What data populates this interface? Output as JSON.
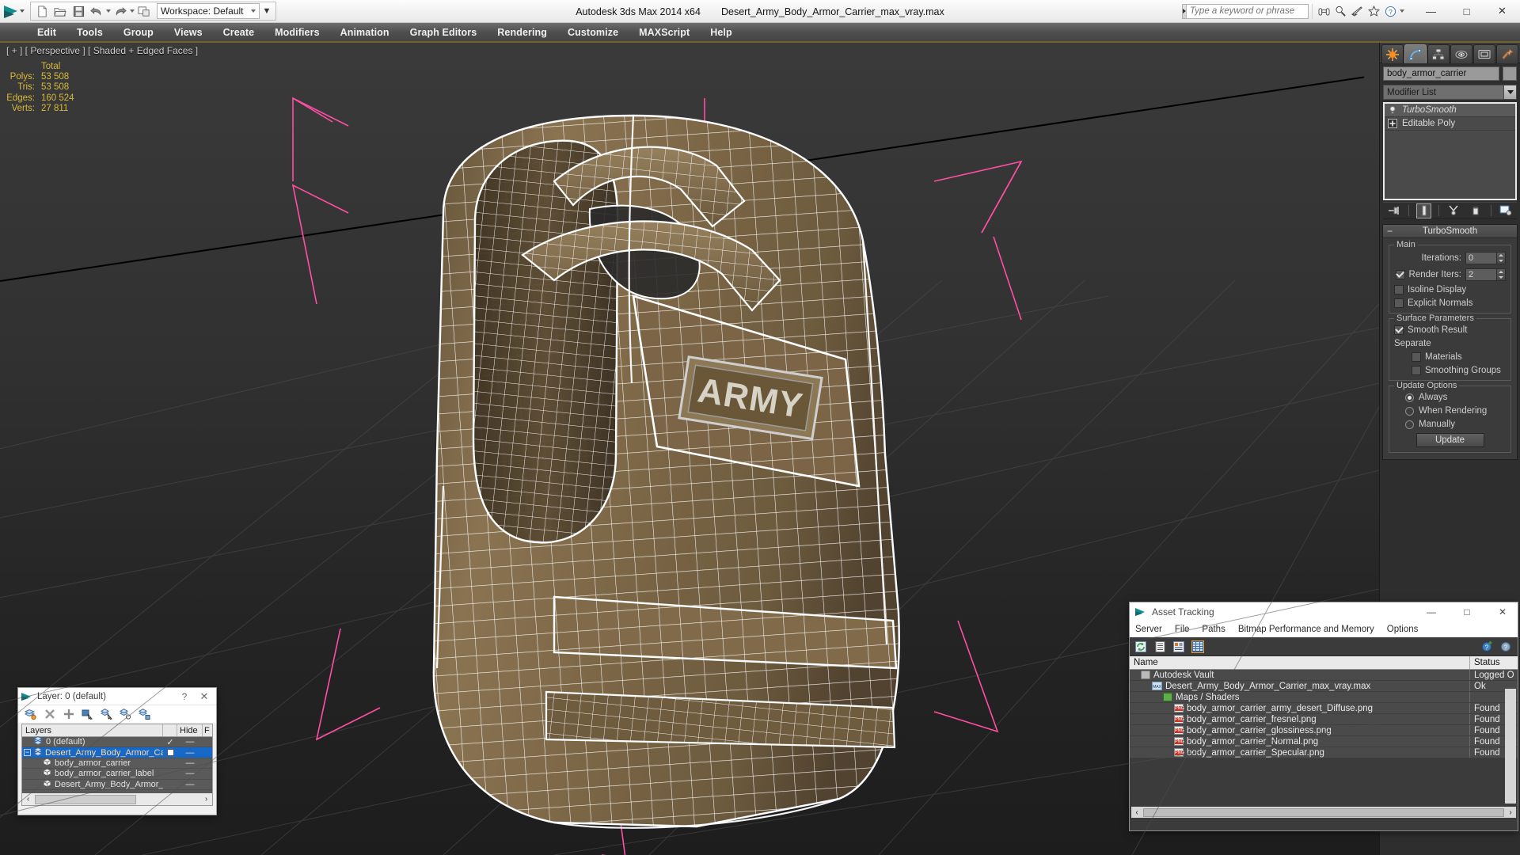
{
  "titlebar": {
    "app_title": "Autodesk 3ds Max  2014 x64",
    "file_title": "Desert_Army_Body_Armor_Carrier_max_vray.max",
    "workspace_label": "Workspace: Default",
    "search_placeholder": "Type a keyword or phrase",
    "quick_access": [
      {
        "name": "new-file-icon",
        "label": "New"
      },
      {
        "name": "open-file-icon",
        "label": "Open"
      },
      {
        "name": "save-file-icon",
        "label": "Save"
      },
      {
        "name": "undo-icon",
        "label": "Undo"
      },
      {
        "name": "redo-icon",
        "label": "Redo"
      },
      {
        "name": "project-folder-icon",
        "label": "Set Project Folder"
      }
    ],
    "help_icons": [
      {
        "name": "binoculars-icon",
        "label": "Search"
      },
      {
        "name": "magnifier-icon",
        "label": "Zoom"
      },
      {
        "name": "satellite-icon",
        "label": "Communication Center"
      },
      {
        "name": "favorites-star-icon",
        "label": "Favorites"
      },
      {
        "name": "help-circle-icon",
        "label": "Help"
      }
    ],
    "window_buttons": {
      "minimize": "—",
      "maximize": "□",
      "close": "✕"
    }
  },
  "menubar": {
    "items": [
      "Edit",
      "Tools",
      "Group",
      "Views",
      "Create",
      "Modifiers",
      "Animation",
      "Graph Editors",
      "Rendering",
      "Customize",
      "MAXScript",
      "Help"
    ]
  },
  "viewport": {
    "label": "[ + ] [ Perspective ] [ Shaded + Edged Faces ]",
    "stats": {
      "header": "Total",
      "rows": [
        {
          "label": "Polys:",
          "value": "53 508"
        },
        {
          "label": "Tris:",
          "value": "53 508"
        },
        {
          "label": "Edges:",
          "value": "160 524"
        },
        {
          "label": "Verts:",
          "value": "27 811"
        }
      ]
    },
    "colors": {
      "stats_text": "#d8bb38",
      "wireframe": "#ffffff",
      "material_base": "#7e6848",
      "material_light": "#9b8361",
      "material_dark": "#4c3e2a",
      "selection_gizmo": "#ff4fa3",
      "background_top": "#3a3a3a",
      "background_bottom": "#1d1d1d"
    },
    "model_name": "Desert Army Body Armor Carrier",
    "patch_text": "ARMY"
  },
  "command_panel": {
    "tabs": [
      {
        "name": "create-tab",
        "label": "Create"
      },
      {
        "name": "modify-tab",
        "label": "Modify",
        "active": true
      },
      {
        "name": "hierarchy-tab",
        "label": "Hierarchy"
      },
      {
        "name": "motion-tab",
        "label": "Motion"
      },
      {
        "name": "display-tab",
        "label": "Display"
      },
      {
        "name": "utilities-tab",
        "label": "Utilities"
      }
    ],
    "object_name": "body_armor_carrier",
    "modifier_list_label": "Modifier List",
    "stack": [
      {
        "label": "TurboSmooth",
        "selected": true,
        "italic": true
      },
      {
        "label": "Editable Poly",
        "selected": false,
        "italic": false
      }
    ],
    "stack_buttons": [
      {
        "name": "pin-stack-button",
        "glyph": "→ᵢ"
      },
      {
        "name": "show-end-result-button",
        "glyph": "I"
      },
      {
        "name": "make-unique-button",
        "glyph": "⑂"
      },
      {
        "name": "remove-modifier-button",
        "glyph": "⚲"
      },
      {
        "name": "configure-modifier-sets-button",
        "glyph": "▦"
      }
    ],
    "rollout": {
      "title": "TurboSmooth",
      "collapse_glyph": "−",
      "groups": [
        {
          "title": "Main",
          "iterations_label": "Iterations:",
          "iterations_value": "0",
          "render_iters_label": "Render Iters:",
          "render_iters_value": "2",
          "render_iters_checked": true,
          "isoline_label": "Isoline Display",
          "isoline_checked": false,
          "explicit_label": "Explicit Normals",
          "explicit_checked": false
        },
        {
          "title": "Surface Parameters",
          "smooth_result_label": "Smooth Result",
          "smooth_result_checked": true,
          "separate_label": "Separate",
          "materials_label": "Materials",
          "materials_checked": false,
          "smoothing_groups_label": "Smoothing Groups",
          "smoothing_groups_checked": false
        },
        {
          "title": "Update Options",
          "options": [
            {
              "label": "Always",
              "selected": true
            },
            {
              "label": "When Rendering",
              "selected": false
            },
            {
              "label": "Manually",
              "selected": false
            }
          ],
          "update_button": "Update"
        }
      ]
    }
  },
  "layer_dialog": {
    "title": "Layer: 0 (default)",
    "help_glyph": "?",
    "close_glyph": "✕",
    "toolbar": [
      {
        "name": "create-new-layer-icon"
      },
      {
        "name": "delete-layer-icon"
      },
      {
        "name": "add-selection-to-layer-icon"
      },
      {
        "name": "select-objects-in-layer-icon"
      },
      {
        "name": "highlight-selected-objects-icon"
      },
      {
        "name": "hide-layer-icon"
      },
      {
        "name": "layer-properties-icon"
      }
    ],
    "columns": [
      "Layers",
      "",
      "Hide",
      "F"
    ],
    "rows": [
      {
        "label": "0 (default)",
        "type": "layer",
        "indent": 1,
        "selected": false,
        "current": true,
        "expander": "",
        "hide": "—"
      },
      {
        "label": "Desert_Army_Body_Armor_Carrier",
        "type": "layer",
        "indent": 0,
        "selected": true,
        "current": false,
        "expander": "−",
        "hide": "—"
      },
      {
        "label": "body_armor_carrier",
        "type": "object",
        "indent": 2,
        "selected": false,
        "current": false,
        "expander": "",
        "hide": "—"
      },
      {
        "label": "body_armor_carrier_label",
        "type": "object",
        "indent": 2,
        "selected": false,
        "current": false,
        "expander": "",
        "hide": "—"
      },
      {
        "label": "Desert_Army_Body_Armor_Carrier",
        "type": "object",
        "indent": 2,
        "selected": false,
        "current": false,
        "expander": "",
        "hide": "—"
      }
    ],
    "scroll_left": "‹",
    "scroll_right": "›"
  },
  "asset_tracking": {
    "title": "Asset Tracking",
    "window_buttons": {
      "minimize": "—",
      "maximize": "□",
      "close": "✕"
    },
    "menu": [
      "Server",
      "File",
      "Paths",
      "Bitmap Performance and Memory",
      "Options"
    ],
    "toolbar": [
      {
        "name": "refresh-icon"
      },
      {
        "name": "list-view-icon"
      },
      {
        "name": "details-view-icon"
      },
      {
        "name": "grid-view-icon",
        "selected": true
      }
    ],
    "toolbar_right": [
      {
        "name": "add-help-icon"
      },
      {
        "name": "help-icon"
      }
    ],
    "columns": [
      "Name",
      "Status"
    ],
    "rows": [
      {
        "name": "Autodesk Vault",
        "status": "Logged O",
        "indent": 1,
        "icon": "vault-icon"
      },
      {
        "name": "Desert_Army_Body_Armor_Carrier_max_vray.max",
        "status": "Ok",
        "indent": 2,
        "icon": "max-file-icon"
      },
      {
        "name": "Maps / Shaders",
        "status": "",
        "indent": 3,
        "icon": "maps-shaders-icon"
      },
      {
        "name": "body_armor_carrier_army_desert_Diffuse.png",
        "status": "Found",
        "indent": 4,
        "icon": "png-file-icon"
      },
      {
        "name": "body_armor_carrier_fresnel.png",
        "status": "Found",
        "indent": 4,
        "icon": "png-file-icon"
      },
      {
        "name": "body_armor_carrier_glossiness.png",
        "status": "Found",
        "indent": 4,
        "icon": "png-file-icon"
      },
      {
        "name": "body_armor_carrier_Normal.png",
        "status": "Found",
        "indent": 4,
        "icon": "png-file-icon"
      },
      {
        "name": "body_armor_carrier_Specular.png",
        "status": "Found",
        "indent": 4,
        "icon": "png-file-icon"
      }
    ],
    "scroll_left": "‹",
    "scroll_right": "›"
  }
}
